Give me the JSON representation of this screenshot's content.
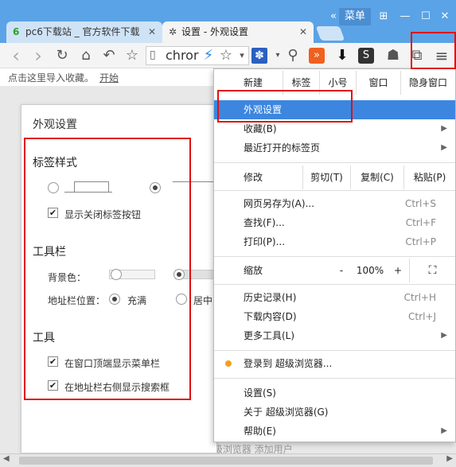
{
  "window": {
    "menu_label": "菜单",
    "collapse_glyph": "«",
    "grid_glyph": "⊞",
    "minimize_glyph": "—",
    "maximize_glyph": "☐",
    "close_glyph": "✕"
  },
  "tabs": [
    {
      "favicon": "6",
      "title": "pc6下载站 _ 官方软件下载",
      "close": "✕"
    },
    {
      "favicon": "✲",
      "title": "设置 - 外观设置",
      "close": "✕"
    }
  ],
  "toolbar": {
    "back": "‹",
    "forward": "›",
    "reload": "↻",
    "home": "⌂",
    "undo": "↶",
    "star": "☆",
    "url_text": "chror",
    "lightning": "⚡",
    "star2": "☆",
    "chevron": "▾",
    "paw": "✽",
    "search": "⚲",
    "download": "⬇",
    "users": "☗",
    "window_icon": "⧉",
    "menu_icon": "≡"
  },
  "bookmarks": {
    "hint": "点击这里导入收藏。",
    "start": "开始"
  },
  "dialog": {
    "title": "外观设置",
    "tab_style_title": "标签样式",
    "show_close_label": "显示关闭标签按钮",
    "toolbar_title": "工具栏",
    "bg_color_label": "背景色：",
    "address_pos_label": "地址栏位置：",
    "fill_label": "充满",
    "center_label": "居中",
    "tools_title": "工具",
    "show_menubar_label": "在窗口顶端显示菜单栏",
    "show_searchbox_label": "在地址栏右侧显示搜索框"
  },
  "menu": {
    "top_row": [
      "新建",
      "标签",
      "小号",
      "窗口",
      "隐身窗口"
    ],
    "appearance": "外观设置",
    "favorites": "收藏(B)",
    "recent_tabs": "最近打开的标签页",
    "edit_row": [
      "修改",
      "剪切(T)",
      "复制(C)",
      "粘贴(P)"
    ],
    "save_as": "网页另存为(A)...",
    "save_as_shortcut": "Ctrl+S",
    "find": "查找(F)...",
    "find_shortcut": "Ctrl+F",
    "print": "打印(P)...",
    "print_shortcut": "Ctrl+P",
    "zoom_label": "缩放",
    "zoom_minus": "-",
    "zoom_value": "100%",
    "zoom_plus": "+",
    "zoom_fullscreen": "⛶",
    "history": "历史记录(H)",
    "history_shortcut": "Ctrl+H",
    "downloads": "下载内容(D)",
    "downloads_shortcut": "Ctrl+J",
    "more_tools": "更多工具(L)",
    "login": "登录到 超级浏览器...",
    "settings": "设置(S)",
    "about": "关于 超级浏览器(G)",
    "help": "帮助(E)",
    "submenu_arrow": "▶"
  },
  "page": {
    "faded_text": "允许任何人向 超级浏览器 添加用户"
  },
  "colors": {
    "titlebar": "#5aa3e6",
    "highlight": "#3c86e0",
    "annotation_red": "#e01010"
  }
}
